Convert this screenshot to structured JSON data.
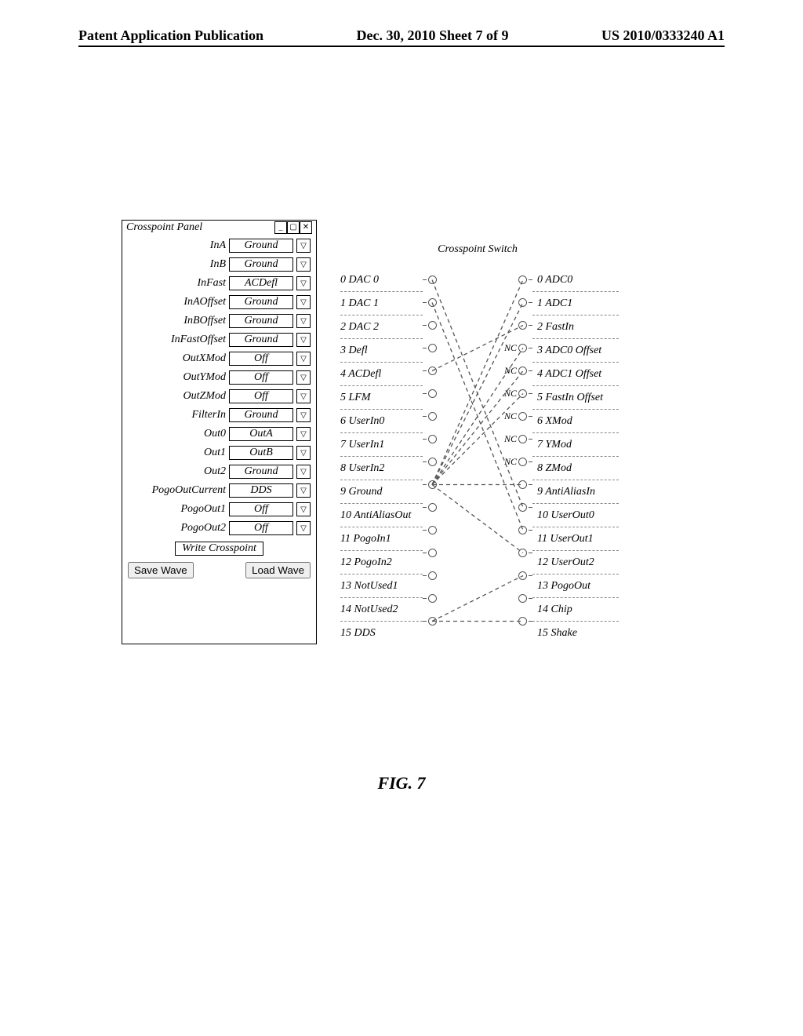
{
  "header": {
    "left": "Patent Application Publication",
    "center": "Dec. 30, 2010  Sheet 7 of 9",
    "right": "US 2010/0333240 A1"
  },
  "panel": {
    "title": "Crosspoint Panel",
    "rows": [
      {
        "label": "InA",
        "value": "Ground"
      },
      {
        "label": "InB",
        "value": "Ground"
      },
      {
        "label": "InFast",
        "value": "ACDefl"
      },
      {
        "label": "InAOffset",
        "value": "Ground"
      },
      {
        "label": "InBOffset",
        "value": "Ground"
      },
      {
        "label": "InFastOffset",
        "value": "Ground"
      },
      {
        "label": "OutXMod",
        "value": "Off"
      },
      {
        "label": "OutYMod",
        "value": "Off"
      },
      {
        "label": "OutZMod",
        "value": "Off"
      },
      {
        "label": "FilterIn",
        "value": "Ground"
      },
      {
        "label": "Out0",
        "value": "OutA"
      },
      {
        "label": "Out1",
        "value": "OutB"
      },
      {
        "label": "Out2",
        "value": "Ground"
      },
      {
        "label": "PogoOutCurrent",
        "value": "DDS"
      },
      {
        "label": "PogoOut1",
        "value": "Off"
      },
      {
        "label": "PogoOut2",
        "value": "Off"
      }
    ],
    "write_button": "Write Crosspoint",
    "save_button": "Save Wave",
    "load_button": "Load Wave"
  },
  "diagram": {
    "title": "Crosspoint Switch",
    "left": [
      "0 DAC 0",
      "1 DAC 1",
      "2 DAC 2",
      "3 Defl",
      "4 ACDefl",
      "5 LFM",
      "6 UserIn0",
      "7 UserIn1",
      "8 UserIn2",
      "9 Ground",
      "10 AntiAliasOut",
      "11 PogoIn1",
      "12 PogoIn2",
      "13 NotUsed1",
      "14 NotUsed2",
      "15 DDS"
    ],
    "right": [
      "0 ADC0",
      "1 ADC1",
      "2 FastIn",
      "3 ADC0 Offset",
      "4 ADC1 Offset",
      "5 FastIn Offset",
      "6 XMod",
      "7 YMod",
      "8 ZMod",
      "9 AntiAliasIn",
      "10 UserOut0",
      "11 UserOut1",
      "12 UserOut2",
      "13 PogoOut",
      "14 Chip",
      "15 Shake"
    ],
    "nc_right": [
      3,
      4,
      5,
      6,
      7,
      8
    ],
    "connections": [
      [
        9,
        0
      ],
      [
        9,
        1
      ],
      [
        4,
        2
      ],
      [
        9,
        3
      ],
      [
        9,
        4
      ],
      [
        9,
        5
      ],
      [
        0,
        10
      ],
      [
        1,
        11
      ],
      [
        9,
        12
      ],
      [
        15,
        13
      ],
      [
        9,
        9
      ],
      [
        15,
        15
      ]
    ]
  },
  "caption": "FIG. 7"
}
